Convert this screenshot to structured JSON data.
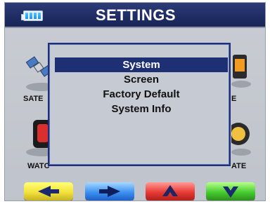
{
  "header": {
    "title": "SETTINGS",
    "battery_icon": "battery-icon"
  },
  "background_items": [
    {
      "label": "SATE",
      "icon": "satellite-icon"
    },
    {
      "label": "E",
      "icon": "tools-icon"
    },
    {
      "label": "WATC",
      "icon": "car-icon"
    },
    {
      "label": "ATE",
      "icon": "speedometer-icon"
    }
  ],
  "dialog": {
    "items": [
      {
        "label": "System",
        "selected": true
      },
      {
        "label": "Screen",
        "selected": false
      },
      {
        "label": "Factory Default",
        "selected": false
      },
      {
        "label": "System Info",
        "selected": false
      }
    ]
  },
  "nav_buttons": [
    {
      "name": "left",
      "icon": "arrow-left-icon",
      "color": "#f2e23c"
    },
    {
      "name": "right",
      "icon": "arrow-right-icon",
      "color": "#3b92f0"
    },
    {
      "name": "up",
      "icon": "arrow-up-icon",
      "color": "#e83a34"
    },
    {
      "name": "down",
      "icon": "arrow-down-icon",
      "color": "#46cc2f"
    }
  ],
  "colors": {
    "header_bg": "#1f2c63",
    "selection_bg": "#1f2f74",
    "dialog_bg": "#c6cad2"
  }
}
